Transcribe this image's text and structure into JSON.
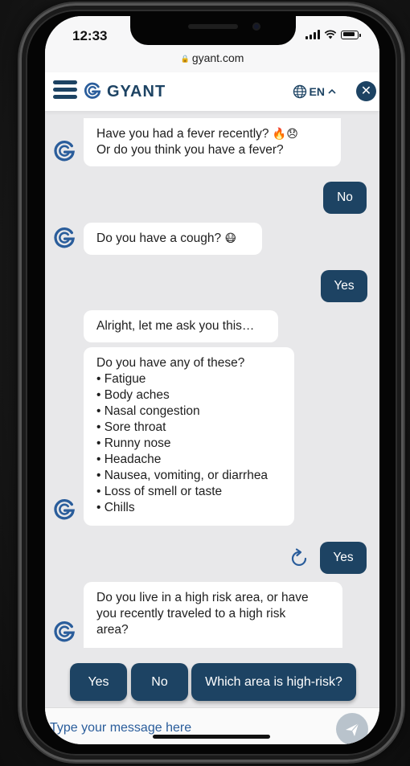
{
  "status_bar": {
    "time": "12:33"
  },
  "browser": {
    "url": "gyant.com"
  },
  "header": {
    "brand": "GYANT",
    "language": "EN"
  },
  "conversation": {
    "q_fever_line1": "Have you had a fever recently?",
    "q_fever_emoji": "🔥😞",
    "q_fever_line2": "Or do you think you have a fever?",
    "a_fever": "No",
    "q_cough": "Do you have a cough?",
    "q_cough_emoji": "😷",
    "a_cough": "Yes",
    "transition": "Alright, let me ask you this…",
    "q_symptoms_intro": "Do you have any of these?",
    "symptoms": [
      "• Fatigue",
      "• Body aches",
      "• Nasal congestion",
      "• Sore throat",
      "• Runny nose",
      "• Headache",
      "• Nausea, vomiting, or diarrhea",
      "• Loss of smell or taste",
      "• Chills"
    ],
    "a_symptoms": "Yes",
    "q_risk_line1": "Do you live in a high risk area, or have",
    "q_risk_line2": "you recently traveled to a high risk",
    "q_risk_line3": "area?"
  },
  "quick_replies": [
    "Yes",
    "No",
    "Which area is high-risk?"
  ],
  "input": {
    "placeholder": "Type your message here"
  },
  "colors": {
    "brand_navy": "#1d4363",
    "bubble_bot": "#ffffff",
    "chat_bg": "#e8e8ea"
  }
}
